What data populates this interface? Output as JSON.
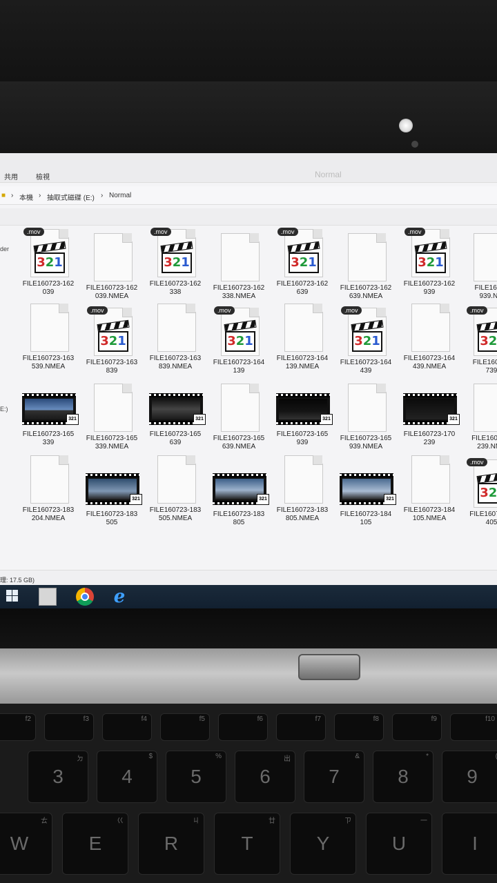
{
  "ribbon": {
    "tab1": "共用",
    "tab2": "檢視",
    "window_title": "Normal"
  },
  "breadcrumb": {
    "part1": "本機",
    "part2": "抽取式磁碟 (E:)",
    "part3": "Normal"
  },
  "left_pane": {
    "folder_label": "der",
    "drive_label": "E:)"
  },
  "files": [
    {
      "line1": "FILE160723-162",
      "line2": "039",
      "kind": "mov"
    },
    {
      "line1": "FILE160723-162",
      "line2": "039.NMEA",
      "kind": "doc"
    },
    {
      "line1": "FILE160723-162",
      "line2": "338",
      "kind": "mov"
    },
    {
      "line1": "FILE160723-162",
      "line2": "338.NMEA",
      "kind": "doc"
    },
    {
      "line1": "FILE160723-162",
      "line2": "639",
      "kind": "mov"
    },
    {
      "line1": "FILE160723-162",
      "line2": "639.NMEA",
      "kind": "doc"
    },
    {
      "line1": "FILE160723-162",
      "line2": "939",
      "kind": "mov"
    },
    {
      "line1": "FILE16072",
      "line2": "939.NM",
      "kind": "doc"
    },
    {
      "line1": "FILE160723-163",
      "line2": "539.NMEA",
      "kind": "doc"
    },
    {
      "line1": "FILE160723-163",
      "line2": "839",
      "kind": "mov"
    },
    {
      "line1": "FILE160723-163",
      "line2": "839.NMEA",
      "kind": "doc"
    },
    {
      "line1": "FILE160723-164",
      "line2": "139",
      "kind": "mov"
    },
    {
      "line1": "FILE160723-164",
      "line2": "139.NMEA",
      "kind": "doc"
    },
    {
      "line1": "FILE160723-164",
      "line2": "439",
      "kind": "mov"
    },
    {
      "line1": "FILE160723-164",
      "line2": "439.NMEA",
      "kind": "doc"
    },
    {
      "line1": "FILE160723",
      "line2": "739",
      "kind": "mov"
    },
    {
      "line1": "FILE160723-165",
      "line2": "339",
      "kind": "video"
    },
    {
      "line1": "FILE160723-165",
      "line2": "339.NMEA",
      "kind": "doc"
    },
    {
      "line1": "FILE160723-165",
      "line2": "639",
      "kind": "video"
    },
    {
      "line1": "FILE160723-165",
      "line2": "639.NMEA",
      "kind": "doc"
    },
    {
      "line1": "FILE160723-165",
      "line2": "939",
      "kind": "video"
    },
    {
      "line1": "FILE160723-165",
      "line2": "939.NMEA",
      "kind": "doc"
    },
    {
      "line1": "FILE160723-170",
      "line2": "239",
      "kind": "video"
    },
    {
      "line1": "FILE160723-",
      "line2": "239.NME",
      "kind": "doc"
    },
    {
      "line1": "FILE160723-183",
      "line2": "204.NMEA",
      "kind": "doc"
    },
    {
      "line1": "FILE160723-183",
      "line2": "505",
      "kind": "video"
    },
    {
      "line1": "FILE160723-183",
      "line2": "505.NMEA",
      "kind": "doc"
    },
    {
      "line1": "FILE160723-183",
      "line2": "805",
      "kind": "video"
    },
    {
      "line1": "FILE160723-183",
      "line2": "805.NMEA",
      "kind": "doc"
    },
    {
      "line1": "FILE160723-184",
      "line2": "105",
      "kind": "video"
    },
    {
      "line1": "FILE160723-184",
      "line2": "105.NMEA",
      "kind": "doc"
    },
    {
      "line1": "FILE160723-1",
      "line2": "405",
      "kind": "mov"
    }
  ],
  "file_icon": {
    "mov_tag": ".mov",
    "player_digits": "321",
    "badge": "321"
  },
  "status_bar": {
    "text": "理: 17.5 GB)"
  },
  "keyboard": {
    "fn_row": [
      "f2",
      "f3",
      "f4",
      "f5",
      "f6",
      "f7",
      "f8",
      "f9",
      "f10"
    ],
    "num_row": [
      "3",
      "4",
      "5",
      "6",
      "7",
      "8",
      "9"
    ],
    "num_sub": [
      "ㄉ",
      "$",
      "%",
      "出",
      "&",
      "*",
      "("
    ],
    "letter_row": [
      "W",
      "E",
      "R",
      "T",
      "Y",
      "U",
      "I"
    ],
    "letter_sub": [
      "ㄊ",
      "巜",
      "ㄐ",
      "廿",
      "ㄗ",
      "一",
      "ㄛ"
    ]
  },
  "colors": {
    "screen_bg": "#f4f4f6",
    "taskbar": "#122030",
    "digit_red": "#d02a2a",
    "digit_green": "#1f9a3a",
    "digit_blue": "#2a5bd0"
  }
}
